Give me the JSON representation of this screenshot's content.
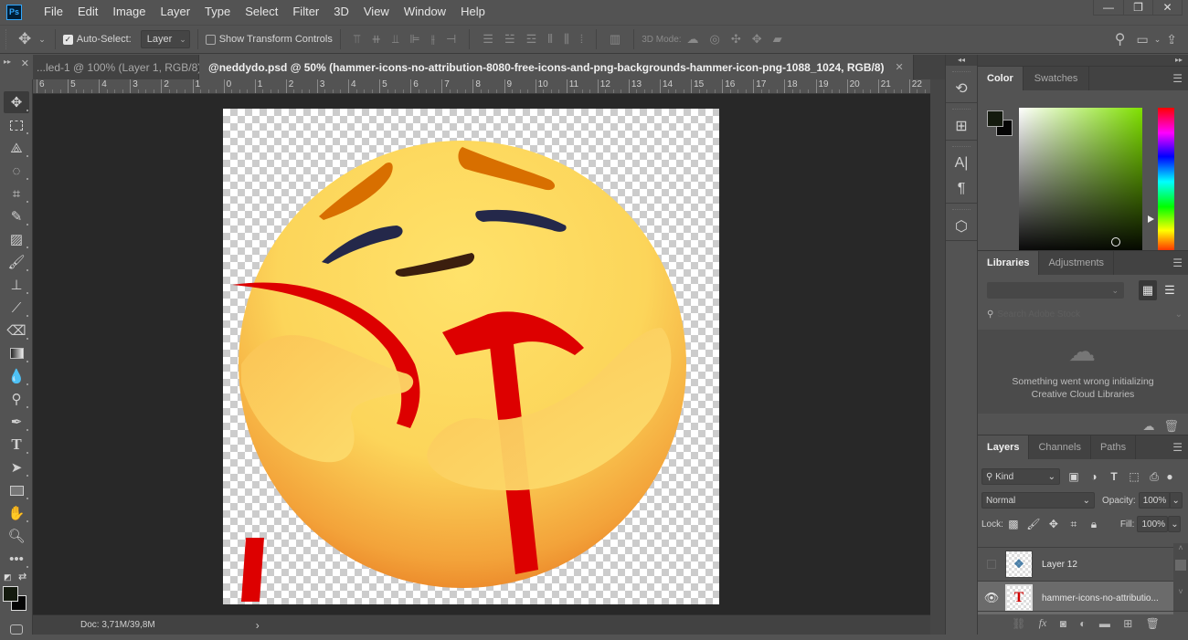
{
  "app": {
    "logo": "Ps",
    "menu": [
      "File",
      "Edit",
      "Image",
      "Layer",
      "Type",
      "Select",
      "Filter",
      "3D",
      "View",
      "Window",
      "Help"
    ],
    "window_controls": {
      "minimize": "—",
      "restore": "❐",
      "close": "✕"
    }
  },
  "options_bar": {
    "move_tool_icon": "move-icon",
    "auto_select_label": "Auto-Select:",
    "auto_select_checked": true,
    "auto_select_target": "Layer",
    "show_transform_label": "Show Transform Controls",
    "show_transform_checked": false,
    "mode_3d_label": "3D Mode:",
    "align_icons": [
      "align-top-edges",
      "align-vertical-centers",
      "align-bottom-edges",
      "align-left-edges",
      "align-horizontal-centers",
      "align-right-edges"
    ],
    "distribute_icons": [
      "distribute-top",
      "distribute-vertical-centers",
      "distribute-bottom",
      "distribute-left",
      "distribute-horizontal-centers",
      "distribute-right"
    ],
    "auto_align_icon": "auto-align-layers",
    "mode_3d_icons": [
      "orbit-3d",
      "roll-3d",
      "drag-3d",
      "slide-3d",
      "scale-3d"
    ]
  },
  "doc_tabs": [
    {
      "title": "...led-1 @ 100% (Layer 1, RGB/8) *",
      "close": "✕",
      "active": false
    },
    {
      "title": "@neddydo.psd @ 50% (hammer-icons-no-attribution-8080-free-icons-and-png-backgrounds-hammer-icon-png-1088_1024, RGB/8)",
      "close": "✕",
      "active": true
    }
  ],
  "ruler": {
    "labels": [
      "6",
      "5",
      "4",
      "3",
      "2",
      "1",
      "0",
      "1",
      "2",
      "3",
      "4",
      "5",
      "6",
      "7",
      "8",
      "9",
      "10",
      "11",
      "12",
      "13",
      "14",
      "15",
      "16",
      "17",
      "18",
      "19",
      "20",
      "21",
      "22"
    ]
  },
  "status_bar": {
    "doc_info": "Doc: 3,71M/39,8M",
    "arrow": "›"
  },
  "tools": [
    "move-tool",
    "marquee-tool",
    "lasso-tool",
    "quick-selection-tool",
    "crop-tool",
    "eyedropper-tool",
    "healing-brush-tool",
    "brush-tool",
    "clone-stamp-tool",
    "history-brush-tool",
    "eraser-tool",
    "gradient-tool",
    "blur-tool",
    "dodge-tool",
    "pen-tool",
    "type-tool",
    "path-selection-tool",
    "rectangle-tool",
    "hand-tool",
    "zoom-tool",
    "edit-toolbar"
  ],
  "colors": {
    "foreground": "#141a0e",
    "background": "#050505",
    "accent_blue": "#31a8ff"
  },
  "color_panel": {
    "tabs": [
      "Color",
      "Swatches"
    ],
    "active_tab": "Color",
    "hue_base": "#7fe000"
  },
  "libraries_panel": {
    "tabs": [
      "Libraries",
      "Adjustments"
    ],
    "active_tab": "Libraries",
    "search_placeholder": "Search Adobe Stock",
    "error_line1": "Something went wrong initializing",
    "error_line2": "Creative Cloud Libraries"
  },
  "layers_panel": {
    "tabs": [
      "Layers",
      "Channels",
      "Paths"
    ],
    "active_tab": "Layers",
    "filter_kind": "Kind",
    "blend_mode": "Normal",
    "opacity_label": "Opacity:",
    "opacity_value": "100%",
    "lock_label": "Lock:",
    "fill_label": "Fill:",
    "fill_value": "100%",
    "layers": [
      {
        "name": "Layer 12",
        "visible": false,
        "selected": false
      },
      {
        "name": "hammer-icons-no-attributio...",
        "visible": true,
        "selected": true
      }
    ]
  },
  "canvas": {
    "image_description": "care emoji hugging red hammer and sickle"
  }
}
